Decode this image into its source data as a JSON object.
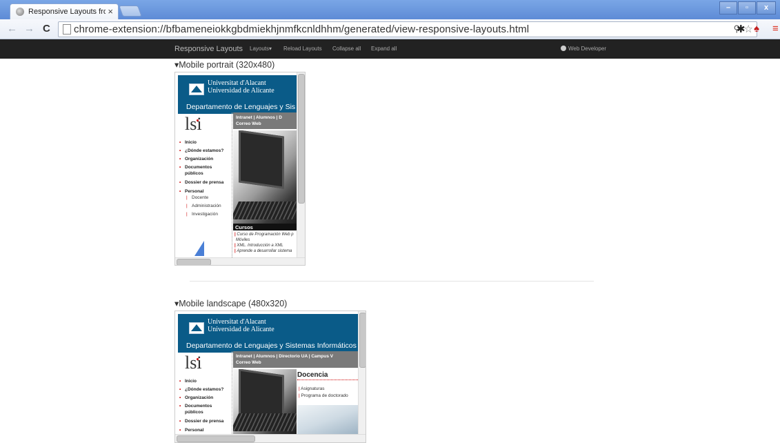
{
  "browser": {
    "tab_title": "Responsive Layouts from htt",
    "tab_close": "×",
    "url": "chrome-extension://bfbameneiokkgbdmiekhjnmfkcnldhhm/generated/view-responsive-layouts.html",
    "window_buttons": {
      "minimize": "–",
      "maximize": "▫",
      "close": "x"
    }
  },
  "devbar": {
    "brand": "Responsive Layouts",
    "items": [
      "Layouts▾",
      "Reload Layouts",
      "Collapse all",
      "Expand all"
    ],
    "right": "Web Developer"
  },
  "layouts": [
    {
      "title": "▾Mobile portrait (320x480)"
    },
    {
      "title": "▾Mobile landscape (480x320)"
    }
  ],
  "site": {
    "uni_line1": "Universitat d'Alacant",
    "uni_line2": "Universidad de Alicante",
    "dept_portrait": "Departamento de Lenguajes y Sis",
    "dept_landscape": "Departamento de Lenguajes y Sistemas Informáticos",
    "logo_text": "lsi",
    "nav_portrait": "Intranet  |  Alumnos  |  D",
    "nav_landscape": "Intranet  |  Alumnos  |  Directorio UA  |  Campus V",
    "nav_line2": "Correo Web",
    "menu": [
      "Inicio",
      "¿Dónde estamos?",
      "Organización",
      "Documentos",
      "públicos",
      "Dossier de prensa",
      "Personal"
    ],
    "submenu": [
      "Docente",
      "Administración",
      "Investigación"
    ],
    "cursos_title": "Cursos",
    "cursos": [
      "Curso de Programación Web p",
      "Móviles",
      "XML. Introducción a XML",
      "Aprende a desarrollar sistema"
    ],
    "docencia_title": "Docencia",
    "docencia": [
      "Asignaturas",
      "Programa de doctorado"
    ]
  }
}
